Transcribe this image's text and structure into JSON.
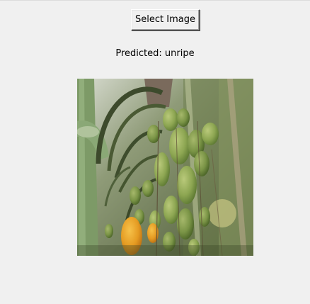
{
  "window": {
    "background": "#f0f0f0"
  },
  "controls": {
    "select_button_label": "Select Image"
  },
  "result": {
    "prediction_text": "Predicted: unripe"
  },
  "image": {
    "description_icon": "photo-palm-fruit-cluster"
  }
}
